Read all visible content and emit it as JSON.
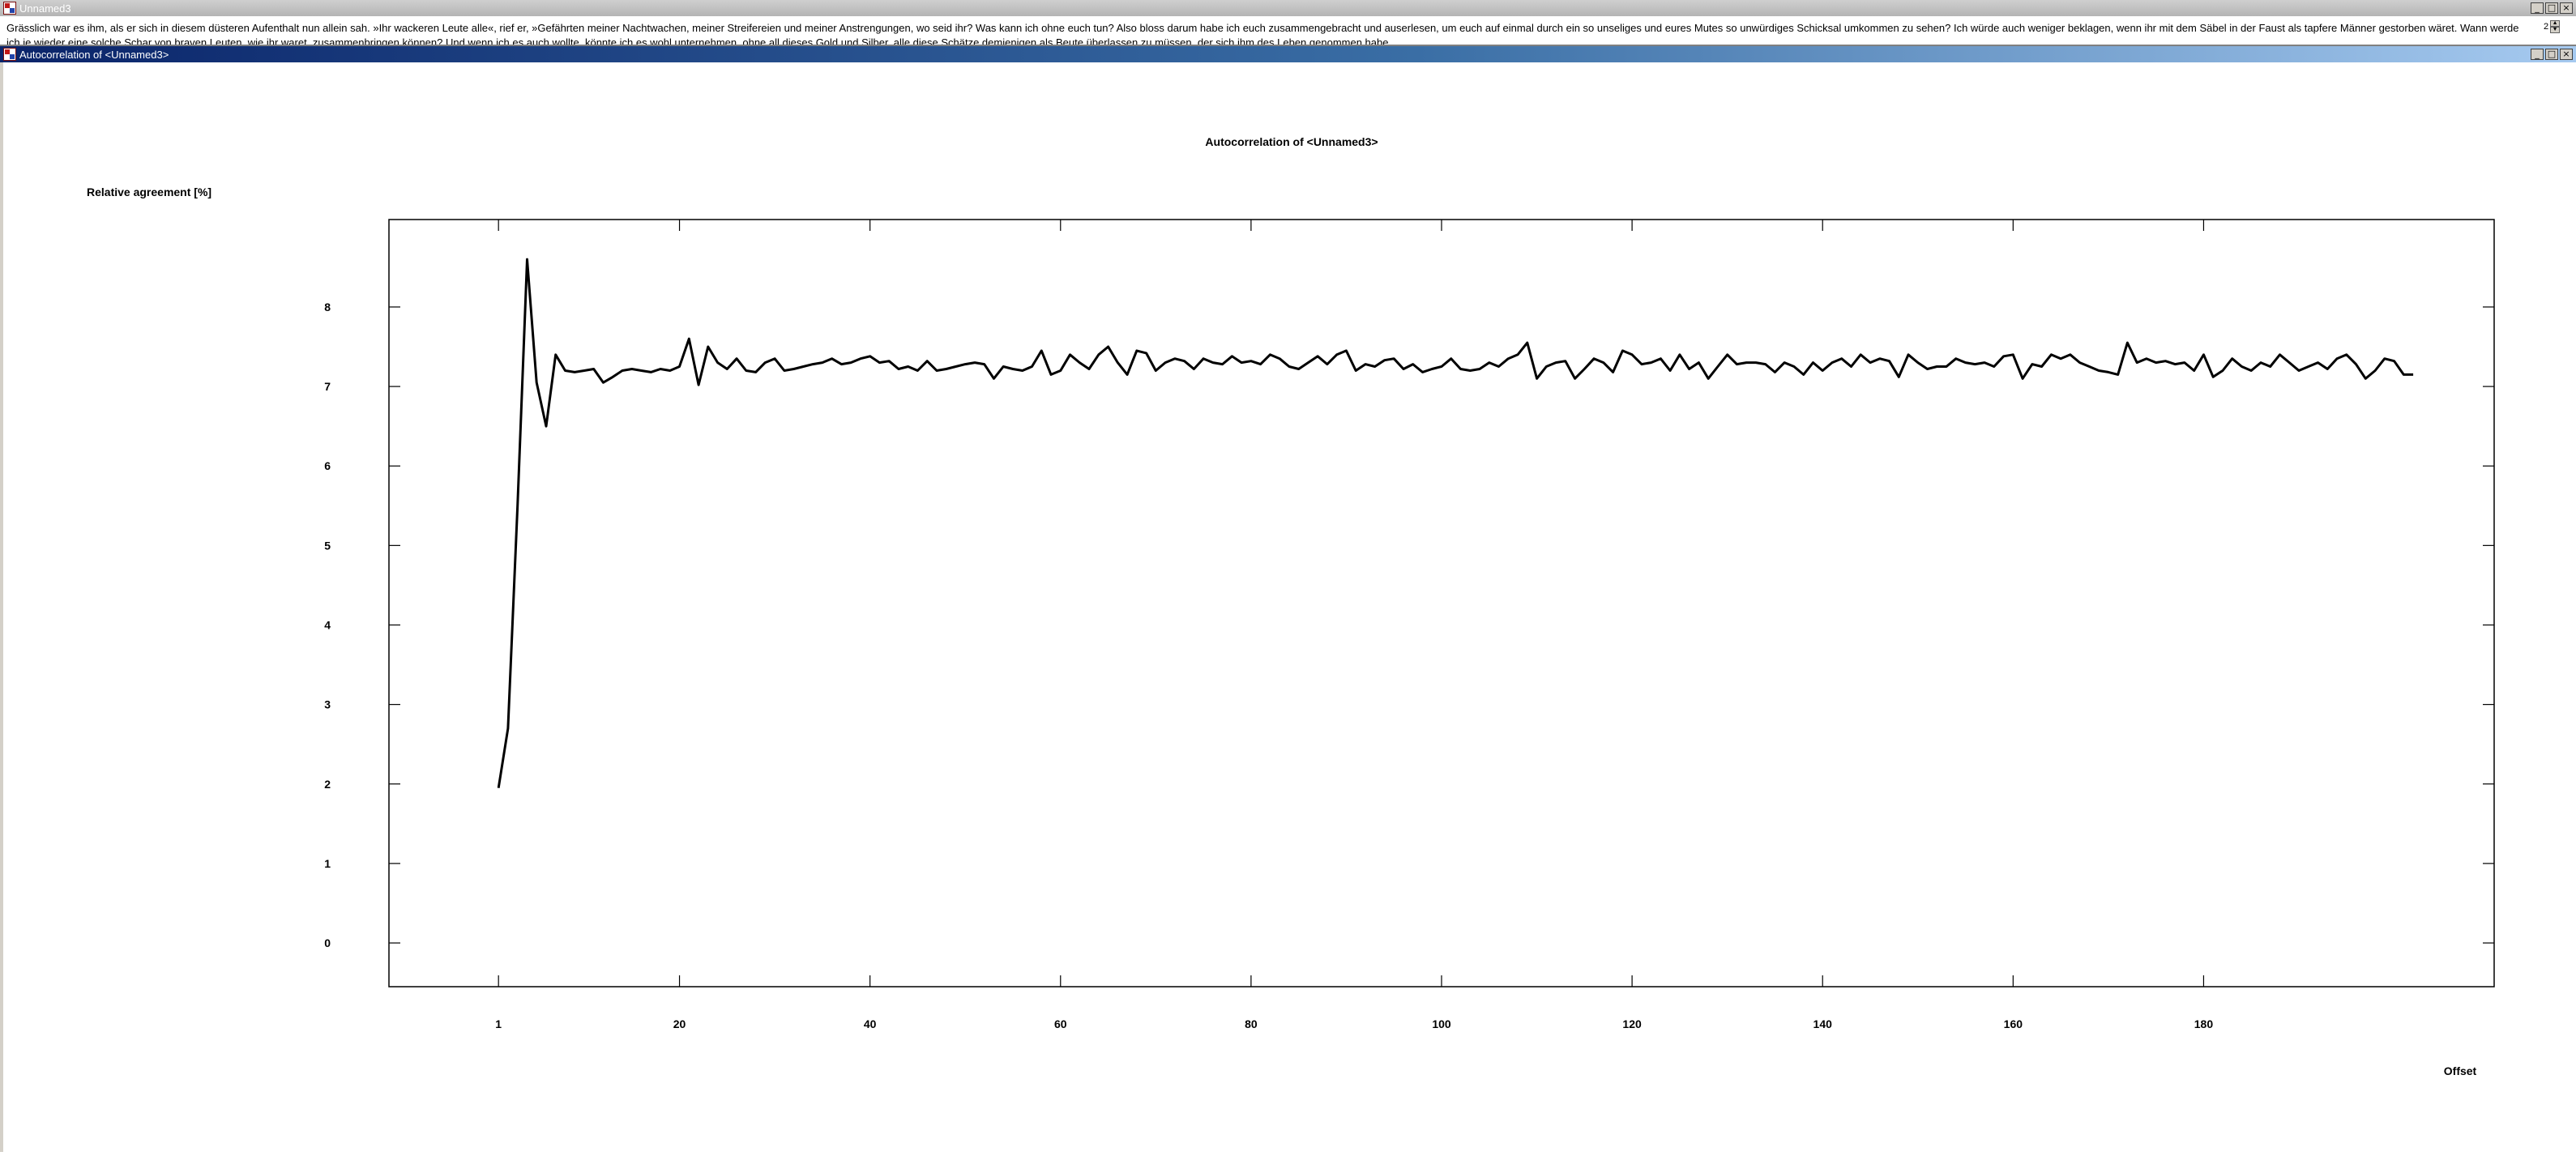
{
  "windows": {
    "main": {
      "title": "Unnamed3"
    },
    "chart": {
      "title": "Autocorrelation of <Unnamed3>"
    }
  },
  "window_buttons": {
    "minimize": "_",
    "maximize": "□",
    "close": "×"
  },
  "text_pane": {
    "content": "Grässlich war es ihm, als er sich in diesem düsteren Aufenthalt nun allein sah. »Ihr wackeren Leute alle«, rief er, »Gefährten meiner Nachtwachen, meiner Streifereien und meiner Anstrengungen, wo seid ihr? Was kann ich ohne euch tun? Also bloss darum habe ich euch zusammengebracht und auserlesen, um euch auf einmal durch ein so unseliges und eures Mutes so unwürdiges Schicksal umkommen zu sehen? Ich würde auch weniger beklagen, wenn ihr mit dem Säbel in der Faust als tapfere Männer gestorben wäret. Wann werde ich je wieder eine solche Schar von braven Leuten, wie ihr waret, zusammenbringen können? Und wenn ich es auch wollte, könnte ich es wohl unternehmen, ohne all dieses Gold und Silber, alle diese Schätze demjenigen als Beute überlassen zu müssen, der sich ihm des Leben genommen habe...",
    "scroll_value": "2"
  },
  "chart_data": {
    "type": "line",
    "title": "Autocorrelation of <Unnamed3>",
    "ylabel": "Relative agreement [%]",
    "xlabel": "Offset",
    "xlim": [
      -10.5,
      210.5
    ],
    "ylim": [
      -0.55,
      9.1
    ],
    "yticks": [
      0,
      1,
      2,
      3,
      4,
      5,
      6,
      7,
      8
    ],
    "xticks": [
      1,
      20,
      40,
      60,
      80,
      100,
      120,
      140,
      160,
      180
    ],
    "grid": false,
    "series": [
      {
        "values": [
          1.95,
          2.7,
          5.5,
          8.6,
          7.05,
          6.5,
          7.4,
          7.2,
          7.18,
          7.2,
          7.22,
          7.05,
          7.12,
          7.2,
          7.22,
          7.2,
          7.18,
          7.22,
          7.2,
          7.25,
          7.6,
          7.02,
          7.5,
          7.3,
          7.22,
          7.35,
          7.2,
          7.18,
          7.3,
          7.35,
          7.2,
          7.22,
          7.25,
          7.28,
          7.3,
          7.35,
          7.28,
          7.3,
          7.35,
          7.38,
          7.3,
          7.32,
          7.22,
          7.25,
          7.2,
          7.32,
          7.2,
          7.22,
          7.25,
          7.28,
          7.3,
          7.28,
          7.1,
          7.25,
          7.22,
          7.2,
          7.25,
          7.45,
          7.15,
          7.2,
          7.4,
          7.3,
          7.22,
          7.4,
          7.5,
          7.3,
          7.15,
          7.45,
          7.42,
          7.2,
          7.3,
          7.35,
          7.32,
          7.22,
          7.35,
          7.3,
          7.28,
          7.38,
          7.3,
          7.32,
          7.28,
          7.4,
          7.35,
          7.25,
          7.22,
          7.3,
          7.38,
          7.28,
          7.4,
          7.45,
          7.2,
          7.28,
          7.25,
          7.33,
          7.35,
          7.22,
          7.28,
          7.18,
          7.22,
          7.25,
          7.35,
          7.22,
          7.2,
          7.22,
          7.3,
          7.25,
          7.35,
          7.4,
          7.55,
          7.1,
          7.25,
          7.3,
          7.32,
          7.1,
          7.22,
          7.35,
          7.3,
          7.18,
          7.45,
          7.4,
          7.28,
          7.3,
          7.35,
          7.2,
          7.4,
          7.22,
          7.3,
          7.1,
          7.25,
          7.4,
          7.28,
          7.3,
          7.3,
          7.28,
          7.18,
          7.3,
          7.25,
          7.15,
          7.3,
          7.2,
          7.3,
          7.35,
          7.25,
          7.4,
          7.3,
          7.35,
          7.32,
          7.12,
          7.4,
          7.3,
          7.22,
          7.25,
          7.25,
          7.35,
          7.3,
          7.28,
          7.3,
          7.25,
          7.38,
          7.4,
          7.1,
          7.28,
          7.25,
          7.4,
          7.35,
          7.4,
          7.3,
          7.25,
          7.2,
          7.18,
          7.15,
          7.55,
          7.3,
          7.35,
          7.3,
          7.32,
          7.28,
          7.3,
          7.2,
          7.4,
          7.12,
          7.2,
          7.35,
          7.25,
          7.2,
          7.3,
          7.25,
          7.4,
          7.3,
          7.2,
          7.25,
          7.3,
          7.22,
          7.35,
          7.4,
          7.28,
          7.1,
          7.2,
          7.35,
          7.32,
          7.15,
          7.15
        ]
      }
    ]
  }
}
